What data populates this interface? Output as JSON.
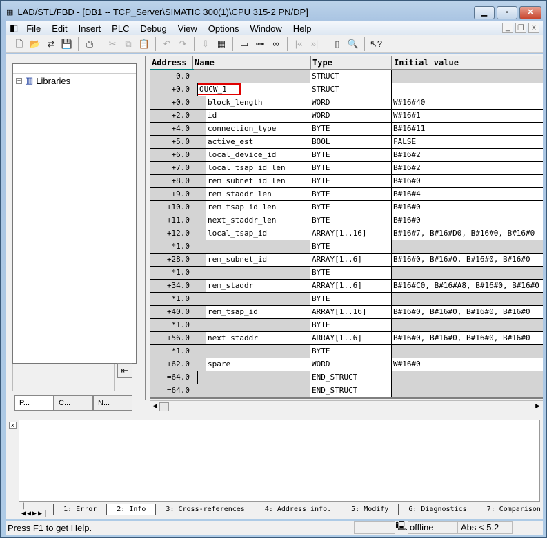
{
  "window": {
    "title": "LAD/STL/FBD  - [DB1 -- TCP_Server\\SIMATIC 300(1)\\CPU 315-2 PN/DP]"
  },
  "menu": [
    "File",
    "Edit",
    "Insert",
    "PLC",
    "Debug",
    "View",
    "Options",
    "Window",
    "Help"
  ],
  "toolbar": [
    "new-icon",
    "open-icon",
    "network-open-icon",
    "save-icon",
    "print-icon",
    "cut-icon",
    "copy-icon",
    "paste-icon",
    "undo-icon",
    "redo-icon",
    "download-icon",
    "monitor-icon",
    "declaration-view-icon",
    "network-icon",
    "glasses-icon",
    "prev-error-icon",
    "next-error-icon",
    "overview-icon",
    "details-icon",
    "help-pointer-icon"
  ],
  "left_panel": {
    "tree_root": "Libraries",
    "tabs": [
      "P...",
      "C...",
      "N..."
    ]
  },
  "table": {
    "headers": [
      "Address",
      "Name",
      "Type",
      "Initial value"
    ],
    "rows": [
      {
        "addr": "0.0",
        "name": "",
        "type": "STRUCT",
        "init": "",
        "kind": "struct"
      },
      {
        "addr": "+0.0",
        "name": "OUCW_1",
        "type": "STRUCT",
        "init": "",
        "kind": "sub",
        "highlight": true
      },
      {
        "addr": "+0.0",
        "name": "block_length",
        "type": "WORD",
        "init": "W#16#40",
        "kind": "el"
      },
      {
        "addr": "+2.0",
        "name": "id",
        "type": "WORD",
        "init": "W#16#1",
        "kind": "el"
      },
      {
        "addr": "+4.0",
        "name": "connection_type",
        "type": "BYTE",
        "init": "B#16#11",
        "kind": "el"
      },
      {
        "addr": "+5.0",
        "name": "active_est",
        "type": "BOOL",
        "init": "FALSE",
        "kind": "el"
      },
      {
        "addr": "+6.0",
        "name": "local_device_id",
        "type": "BYTE",
        "init": "B#16#2",
        "kind": "el"
      },
      {
        "addr": "+7.0",
        "name": "local_tsap_id_len",
        "type": "BYTE",
        "init": "B#16#2",
        "kind": "el"
      },
      {
        "addr": "+8.0",
        "name": "rem_subnet_id_len",
        "type": "BYTE",
        "init": "B#16#0",
        "kind": "el"
      },
      {
        "addr": "+9.0",
        "name": "rem_staddr_len",
        "type": "BYTE",
        "init": "B#16#4",
        "kind": "el"
      },
      {
        "addr": "+10.0",
        "name": "rem_tsap_id_len",
        "type": "BYTE",
        "init": "B#16#0",
        "kind": "el"
      },
      {
        "addr": "+11.0",
        "name": "next_staddr_len",
        "type": "BYTE",
        "init": "B#16#0",
        "kind": "el"
      },
      {
        "addr": "+12.0",
        "name": "local_tsap_id",
        "type": "ARRAY[1..16]",
        "init": "B#16#7, B#16#D0, B#16#0, B#16#0",
        "kind": "el"
      },
      {
        "addr": "*1.0",
        "name": "",
        "type": "BYTE",
        "init": "",
        "kind": "star"
      },
      {
        "addr": "+28.0",
        "name": "rem_subnet_id",
        "type": "ARRAY[1..6]",
        "init": "B#16#0, B#16#0, B#16#0, B#16#0",
        "kind": "el"
      },
      {
        "addr": "*1.0",
        "name": "",
        "type": "BYTE",
        "init": "",
        "kind": "star"
      },
      {
        "addr": "+34.0",
        "name": "rem_staddr",
        "type": "ARRAY[1..6]",
        "init": "B#16#C0, B#16#A8, B#16#0, B#16#0",
        "kind": "el"
      },
      {
        "addr": "*1.0",
        "name": "",
        "type": "BYTE",
        "init": "",
        "kind": "star"
      },
      {
        "addr": "+40.0",
        "name": "rem_tsap_id",
        "type": "ARRAY[1..16]",
        "init": "B#16#0, B#16#0, B#16#0, B#16#0",
        "kind": "el"
      },
      {
        "addr": "*1.0",
        "name": "",
        "type": "BYTE",
        "init": "",
        "kind": "star"
      },
      {
        "addr": "+56.0",
        "name": "next_staddr",
        "type": "ARRAY[1..6]",
        "init": "B#16#0, B#16#0, B#16#0, B#16#0",
        "kind": "el"
      },
      {
        "addr": "*1.0",
        "name": "",
        "type": "BYTE",
        "init": "",
        "kind": "star"
      },
      {
        "addr": "+62.0",
        "name": "spare",
        "type": "WORD",
        "init": "W#16#0",
        "kind": "el"
      },
      {
        "addr": "=64.0",
        "name": "",
        "type": "END_STRUCT",
        "init": "",
        "kind": "end1"
      },
      {
        "addr": "=64.0",
        "name": "",
        "type": "END_STRUCT",
        "init": "",
        "kind": "end0"
      }
    ]
  },
  "output_tabs": [
    "1: Error",
    "2: Info",
    "3: Cross-references",
    "4: Address info.",
    "5: Modify",
    "6: Diagnostics",
    "7: Comparison"
  ],
  "status": {
    "help": "Press F1 to get Help.",
    "mode": "offline",
    "abs": "Abs < 5.2"
  },
  "colors": {
    "highlight": "#e00000",
    "selected_cell": "#008080"
  }
}
